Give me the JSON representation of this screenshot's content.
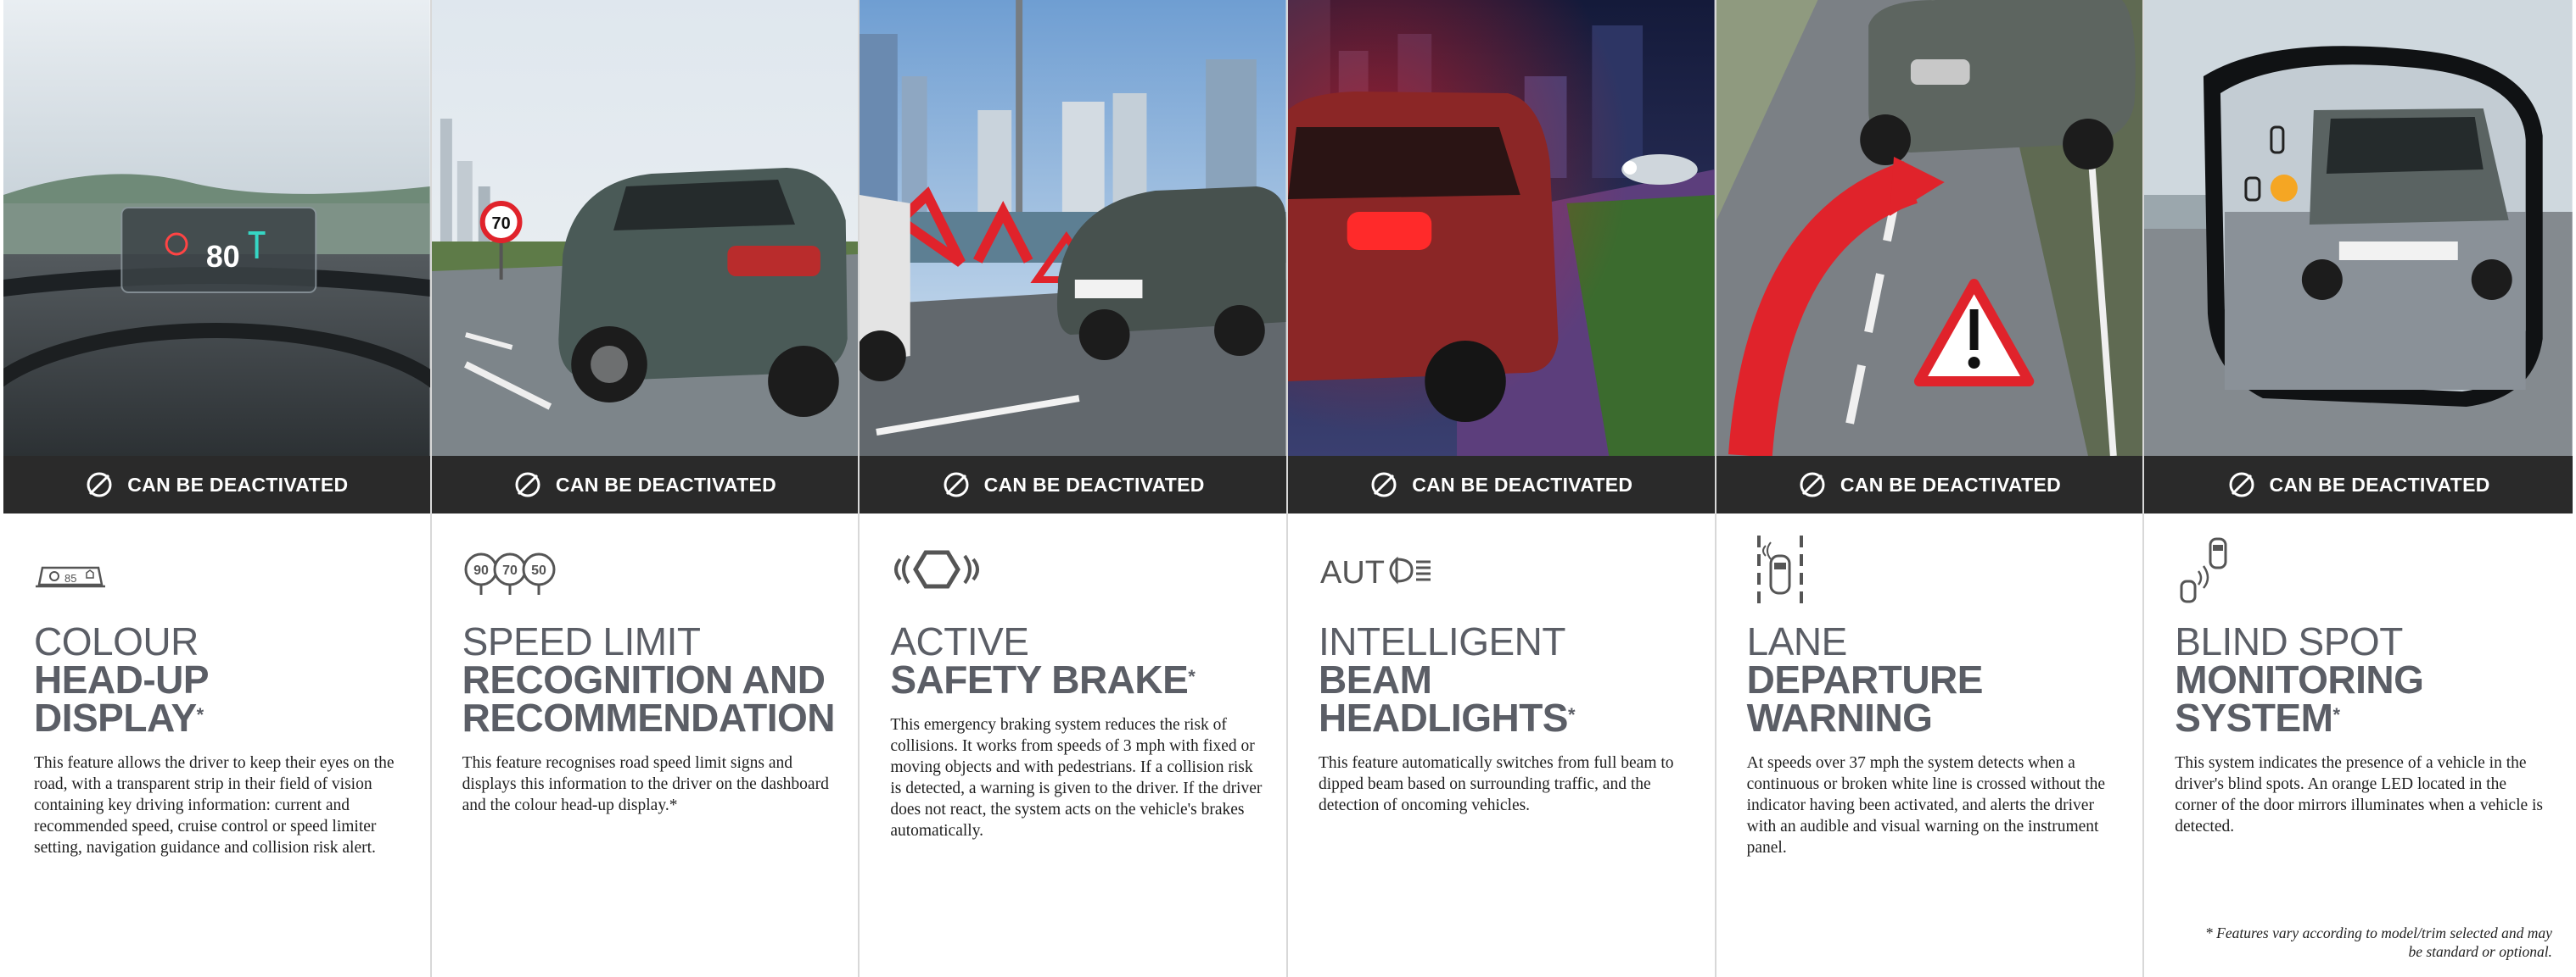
{
  "deactivate_label": "CAN BE DEACTIVATED",
  "features": [
    {
      "icon": "head-up-display-icon",
      "icon_text": "85",
      "title_light": "COLOUR",
      "title_bold_1": "HEAD-UP",
      "title_bold_2": "DISPLAY",
      "title_star": "*",
      "description": "This feature allows the driver to keep their eyes on the road, with a transparent strip in their field of vision containing key driving information: current and recommended speed, cruise control or speed limiter setting, navigation guidance and collision risk alert.",
      "hud_speed": "80"
    },
    {
      "icon": "speed-signs-icon",
      "icon_signs": [
        "90",
        "70",
        "50"
      ],
      "title_light": "SPEED LIMIT",
      "title_bold_1": "RECOGNITION AND",
      "title_bold_2": "RECOMMENDATION",
      "title_star": "",
      "description": "This feature recognises road speed limit signs and displays this information to the driver on the dashboard and the colour head-up display.*",
      "sign_speed": "70"
    },
    {
      "icon": "brake-warning-icon",
      "title_light": "ACTIVE",
      "title_bold_1": "SAFETY BRAKE",
      "title_bold_2": "",
      "title_star": "*",
      "description": "This emergency braking system reduces the risk of collisions. It works from speeds of 3 mph with fixed or moving objects and with pedestrians. If a collision risk is detected, a warning is given to the driver. If the driver does not react, the system acts on the vehicle's brakes automatically."
    },
    {
      "icon": "auto-headlight-icon",
      "icon_text": "AUT",
      "title_light": "INTELLIGENT",
      "title_bold_1": "BEAM",
      "title_bold_2": "HEADLIGHTS",
      "title_star": "*",
      "description": "This feature automatically switches from full beam to dipped beam based on surrounding traffic, and the detection of oncoming vehicles."
    },
    {
      "icon": "lane-departure-icon",
      "title_light": "LANE",
      "title_bold_1": "DEPARTURE",
      "title_bold_2": "WARNING",
      "title_star": "",
      "description": "At speeds over 37 mph the system detects when a continuous or broken white line is crossed without the indicator having been activated, and alerts the driver with an audible and visual warning on the instrument panel."
    },
    {
      "icon": "blind-spot-icon",
      "title_light": "BLIND SPOT",
      "title_bold_1": "MONITORING",
      "title_bold_2": "SYSTEM",
      "title_star": "*",
      "description": "This system indicates the presence of a vehicle in the driver's blind spots. An orange LED located in the corner of the door mirrors illuminates when a vehicle is detected."
    }
  ],
  "footnote": "* Features vary according to model/trim selected and may be standard or optional.",
  "colors": {
    "band": "#2a2a2a",
    "title": "#5b5e66",
    "alert_red": "#e0232b",
    "led_orange": "#f5a623"
  }
}
